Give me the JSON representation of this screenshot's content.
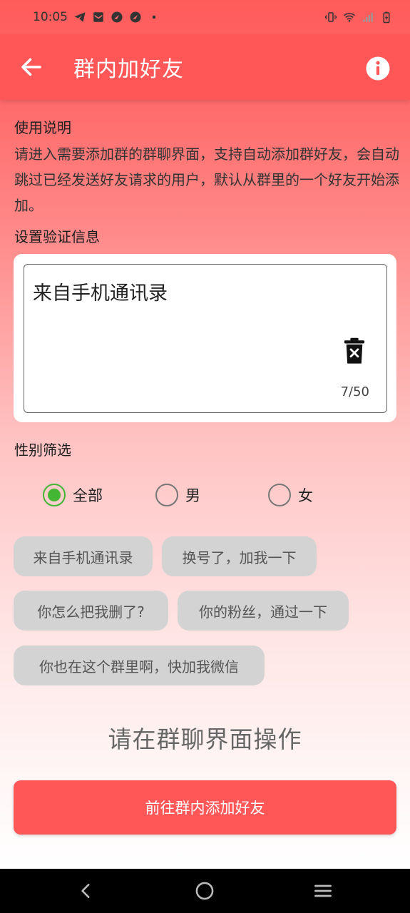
{
  "status_bar": {
    "time": "10:05",
    "left_icons": [
      "telegram-icon",
      "mail-icon",
      "app-notification-icon",
      "app-notification-icon",
      "dot-icon"
    ],
    "right_icons": [
      "vibrate-icon",
      "wifi-icon",
      "signal-icon",
      "battery-charging-icon"
    ]
  },
  "app_bar": {
    "title": "群内加好友",
    "background": "#ff5757"
  },
  "instructions": {
    "heading": "使用说明",
    "text": "请进入需要添加群的群聊界面，支持自动添加群好友，会自动跳过已经发送好友请求的用户，默认从群里的一个好友开始添加。"
  },
  "verification": {
    "heading": "设置验证信息",
    "value": "来自手机通讯录",
    "counter": "7/50"
  },
  "gender_filter": {
    "heading": "性别筛选",
    "options": [
      {
        "label": "全部",
        "checked": true
      },
      {
        "label": "男",
        "checked": false
      },
      {
        "label": "女",
        "checked": false
      }
    ],
    "accent": "#43b734"
  },
  "presets": [
    "来自手机通讯录",
    "换号了，加我一下",
    "你怎么把我删了?",
    "你的粉丝，通过一下",
    "你也在这个群里啊，快加我微信"
  ],
  "hint": "请在群聊界面操作",
  "primary_button": "前往群内添加好友"
}
